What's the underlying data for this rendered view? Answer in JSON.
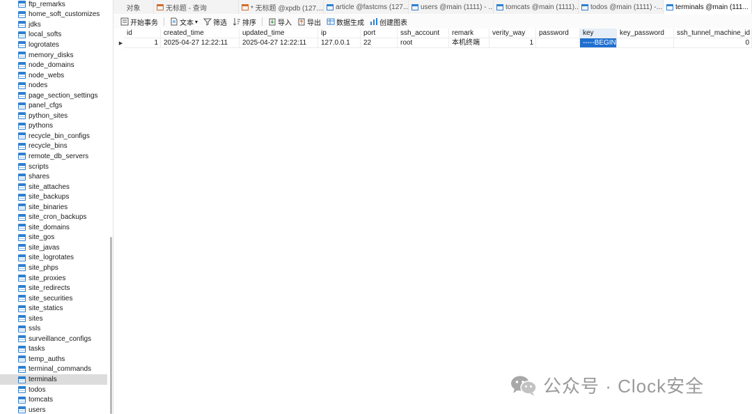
{
  "sidebar": {
    "items": [
      {
        "label": "ftp_remarks"
      },
      {
        "label": "home_soft_customizes"
      },
      {
        "label": "jdks"
      },
      {
        "label": "local_softs"
      },
      {
        "label": "logrotates"
      },
      {
        "label": "memory_disks"
      },
      {
        "label": "node_domains"
      },
      {
        "label": "node_webs"
      },
      {
        "label": "nodes"
      },
      {
        "label": "page_section_settings"
      },
      {
        "label": "panel_cfgs"
      },
      {
        "label": "python_sites"
      },
      {
        "label": "pythons"
      },
      {
        "label": "recycle_bin_configs"
      },
      {
        "label": "recycle_bins"
      },
      {
        "label": "remote_db_servers"
      },
      {
        "label": "scripts"
      },
      {
        "label": "shares"
      },
      {
        "label": "site_attaches"
      },
      {
        "label": "site_backups"
      },
      {
        "label": "site_binaries"
      },
      {
        "label": "site_cron_backups"
      },
      {
        "label": "site_domains"
      },
      {
        "label": "site_gos"
      },
      {
        "label": "site_javas"
      },
      {
        "label": "site_logrotates"
      },
      {
        "label": "site_phps"
      },
      {
        "label": "site_proxies"
      },
      {
        "label": "site_redirects"
      },
      {
        "label": "site_securities"
      },
      {
        "label": "site_statics"
      },
      {
        "label": "sites"
      },
      {
        "label": "ssls"
      },
      {
        "label": "surveillance_configs"
      },
      {
        "label": "tasks"
      },
      {
        "label": "temp_auths"
      },
      {
        "label": "terminal_commands"
      },
      {
        "label": "terminals"
      },
      {
        "label": "todos"
      },
      {
        "label": "tomcats"
      },
      {
        "label": "users"
      }
    ],
    "selected_label": "terminals"
  },
  "tabs": [
    {
      "label": "对象",
      "type": "object"
    },
    {
      "label": "无标题 - 查询",
      "type": "query"
    },
    {
      "label": "* 无标题 @xpdb (127....",
      "type": "query"
    },
    {
      "label": "article @fastcms (127....",
      "type": "table"
    },
    {
      "label": "users @main (1111) - ...",
      "type": "table"
    },
    {
      "label": "tomcats @main (1111)...",
      "type": "table"
    },
    {
      "label": "todos @main (1111) -...",
      "type": "table"
    },
    {
      "label": "terminals @main (111...",
      "type": "table",
      "active": true
    }
  ],
  "toolbar": {
    "begin_transaction": "开始事务",
    "text": "文本",
    "filter": "筛选",
    "sort": "排序",
    "import": "导入",
    "export": "导出",
    "data_generate": "数据生成",
    "create_chart": "创建图表"
  },
  "grid": {
    "columns": [
      "id",
      "created_time",
      "updated_time",
      "ip",
      "port",
      "ssh_account",
      "remark",
      "verity_way",
      "password",
      "key",
      "key_password",
      "ssh_tunnel_machine_id"
    ],
    "rows": [
      {
        "id": "1",
        "created_time": "2025-04-27 12:22:11",
        "updated_time": "2025-04-27 12:22:11",
        "ip": "127.0.0.1",
        "port": "22",
        "ssh_account": "root",
        "remark": "本机终端",
        "verity_way": "1",
        "password": "",
        "key": "-----BEGIN O",
        "key_password": "",
        "ssh_tunnel_machine_id": "0"
      }
    ],
    "selected_column": "key"
  },
  "watermark": {
    "text": "公众号 · Clock安全"
  },
  "colors": {
    "accent": "#1f6fd0",
    "table_icon": "#2f7fd0",
    "selected_row_bg": "#dcdcdc"
  }
}
